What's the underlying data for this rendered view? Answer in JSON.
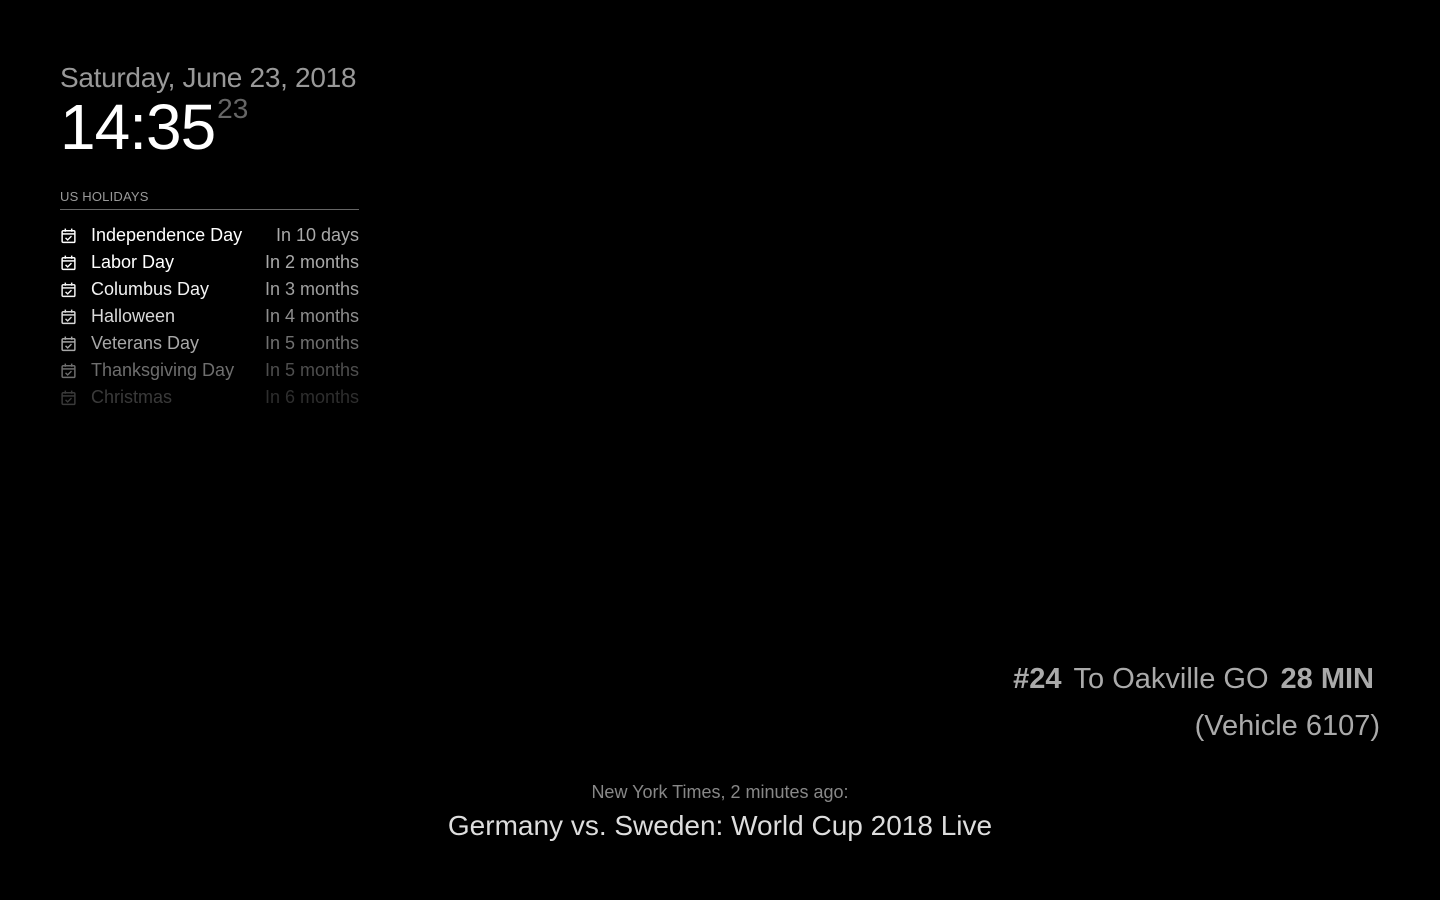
{
  "clock": {
    "date": "Saturday, June 23, 2018",
    "time": "14:35",
    "seconds": "23"
  },
  "calendar": {
    "header": "US HOLIDAYS",
    "icon": "calendar-check-icon",
    "events": [
      {
        "title": "Independence Day",
        "when": "In 10 days",
        "color": "#ffffff",
        "when_color": "#aaaaaa"
      },
      {
        "title": "Labor Day",
        "when": "In 2 months",
        "color": "#ffffff",
        "when_color": "#aaaaaa"
      },
      {
        "title": "Columbus Day",
        "when": "In 3 months",
        "color": "#f2f2f2",
        "when_color": "#a0a0a0"
      },
      {
        "title": "Halloween",
        "when": "In 4 months",
        "color": "#d8d8d8",
        "when_color": "#8e8e8e"
      },
      {
        "title": "Veterans Day",
        "when": "In 5 months",
        "color": "#a8a8a8",
        "when_color": "#707070"
      },
      {
        "title": "Thanksgiving Day",
        "when": "In 5 months",
        "color": "#6e6e6e",
        "when_color": "#4e4e4e"
      },
      {
        "title": "Christmas",
        "when": "In 6 months",
        "color": "#3a3a3a",
        "when_color": "#2e2e2e"
      }
    ]
  },
  "transit": {
    "route": "#24",
    "destination": "To Oakville GO",
    "eta": "28 MIN",
    "vehicle": "(Vehicle 6107)"
  },
  "news": {
    "source": "New York Times, 2 minutes ago:",
    "headline": "Germany vs. Sweden: World Cup 2018 Live"
  }
}
